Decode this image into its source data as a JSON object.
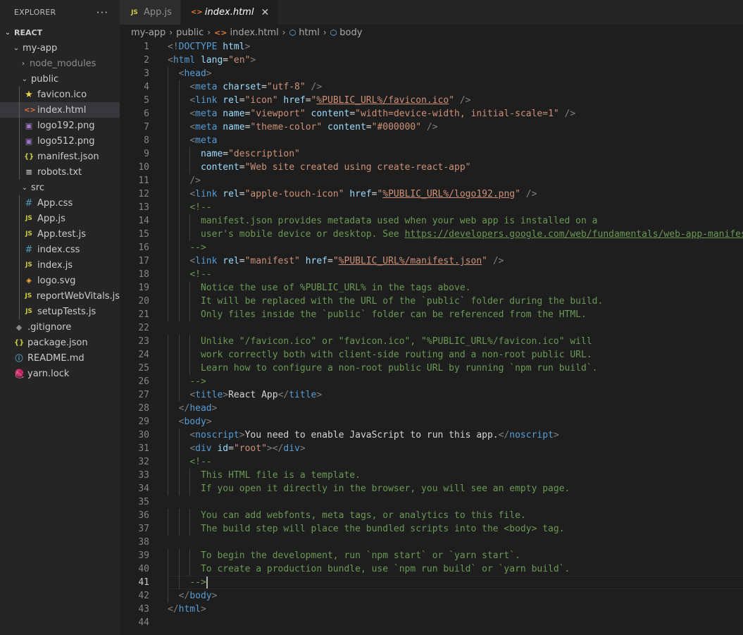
{
  "sidebar": {
    "title": "EXPLORER",
    "more": "···",
    "section": "REACT",
    "items": [
      {
        "label": "my-app",
        "kind": "folder",
        "depth": 1,
        "icon": "chevron-down-icon"
      },
      {
        "label": "node_modules",
        "kind": "folder",
        "depth": 2,
        "icon": "chevron-right-icon"
      },
      {
        "label": "public",
        "kind": "folder",
        "depth": 2,
        "icon": "chevron-down-icon"
      },
      {
        "label": "favicon.ico",
        "kind": "file",
        "depth": 3,
        "icon": "star-icon"
      },
      {
        "label": "index.html",
        "kind": "file",
        "depth": 3,
        "icon": "html-file-icon"
      },
      {
        "label": "logo192.png",
        "kind": "file",
        "depth": 3,
        "icon": "image-file-icon"
      },
      {
        "label": "logo512.png",
        "kind": "file",
        "depth": 3,
        "icon": "image-file-icon"
      },
      {
        "label": "manifest.json",
        "kind": "file",
        "depth": 3,
        "icon": "json-file-icon"
      },
      {
        "label": "robots.txt",
        "kind": "file",
        "depth": 3,
        "icon": "text-file-icon"
      },
      {
        "label": "src",
        "kind": "folder",
        "depth": 2,
        "icon": "chevron-down-icon"
      },
      {
        "label": "App.css",
        "kind": "file",
        "depth": 3,
        "icon": "css-file-icon"
      },
      {
        "label": "App.js",
        "kind": "file",
        "depth": 3,
        "icon": "js-file-icon"
      },
      {
        "label": "App.test.js",
        "kind": "file",
        "depth": 3,
        "icon": "js-test-file-icon"
      },
      {
        "label": "index.css",
        "kind": "file",
        "depth": 3,
        "icon": "css-file-icon"
      },
      {
        "label": "index.js",
        "kind": "file",
        "depth": 3,
        "icon": "js-file-icon"
      },
      {
        "label": "logo.svg",
        "kind": "file",
        "depth": 3,
        "icon": "svg-file-icon"
      },
      {
        "label": "reportWebVitals.js",
        "kind": "file",
        "depth": 3,
        "icon": "js-file-icon"
      },
      {
        "label": "setupTests.js",
        "kind": "file",
        "depth": 3,
        "icon": "js-file-icon"
      },
      {
        "label": ".gitignore",
        "kind": "file",
        "depth": 2,
        "icon": "git-file-icon"
      },
      {
        "label": "package.json",
        "kind": "file",
        "depth": 2,
        "icon": "json-file-icon"
      },
      {
        "label": "README.md",
        "kind": "file",
        "depth": 2,
        "icon": "info-file-icon"
      },
      {
        "label": "yarn.lock",
        "kind": "file",
        "depth": 2,
        "icon": "yarn-file-icon"
      }
    ],
    "selected": "index.html"
  },
  "tabs": [
    {
      "label": "App.js",
      "icon_text": "JS",
      "active": false
    },
    {
      "label": "index.html",
      "icon_text": "<>",
      "active": true,
      "close": "✕"
    }
  ],
  "breadcrumb": [
    "my-app",
    "public",
    "index.html",
    "html",
    "body"
  ],
  "editor": {
    "current_line": 41,
    "lines": [
      [
        [
          "t-p",
          "<!"
        ],
        [
          "t-tag",
          "DOCTYPE"
        ],
        [
          "t-txt",
          " "
        ],
        [
          "t-attr",
          "html"
        ],
        [
          "t-p",
          ">"
        ]
      ],
      [
        [
          "t-p",
          "<"
        ],
        [
          "t-tag",
          "html"
        ],
        [
          "t-txt",
          " "
        ],
        [
          "t-attr",
          "lang"
        ],
        [
          "t-txt",
          "="
        ],
        [
          "t-str",
          "\"en\""
        ],
        [
          "t-p",
          ">"
        ]
      ],
      [
        [
          "t-txt",
          "  "
        ],
        [
          "t-p",
          "<"
        ],
        [
          "t-tag",
          "head"
        ],
        [
          "t-p",
          ">"
        ]
      ],
      [
        [
          "t-txt",
          "    "
        ],
        [
          "t-p",
          "<"
        ],
        [
          "t-tag",
          "meta"
        ],
        [
          "t-txt",
          " "
        ],
        [
          "t-attr",
          "charset"
        ],
        [
          "t-txt",
          "="
        ],
        [
          "t-str",
          "\"utf-8\""
        ],
        [
          "t-txt",
          " "
        ],
        [
          "t-p",
          "/>"
        ]
      ],
      [
        [
          "t-txt",
          "    "
        ],
        [
          "t-p",
          "<"
        ],
        [
          "t-tag",
          "link"
        ],
        [
          "t-txt",
          " "
        ],
        [
          "t-attr",
          "rel"
        ],
        [
          "t-txt",
          "="
        ],
        [
          "t-str",
          "\"icon\""
        ],
        [
          "t-txt",
          " "
        ],
        [
          "t-attr",
          "href"
        ],
        [
          "t-txt",
          "="
        ],
        [
          "t-str",
          "\""
        ],
        [
          "t-url",
          "%PUBLIC_URL%/favicon.ico"
        ],
        [
          "t-str",
          "\""
        ],
        [
          "t-txt",
          " "
        ],
        [
          "t-p",
          "/>"
        ]
      ],
      [
        [
          "t-txt",
          "    "
        ],
        [
          "t-p",
          "<"
        ],
        [
          "t-tag",
          "meta"
        ],
        [
          "t-txt",
          " "
        ],
        [
          "t-attr",
          "name"
        ],
        [
          "t-txt",
          "="
        ],
        [
          "t-str",
          "\"viewport\""
        ],
        [
          "t-txt",
          " "
        ],
        [
          "t-attr",
          "content"
        ],
        [
          "t-txt",
          "="
        ],
        [
          "t-str",
          "\"width=device-width, initial-scale=1\""
        ],
        [
          "t-txt",
          " "
        ],
        [
          "t-p",
          "/>"
        ]
      ],
      [
        [
          "t-txt",
          "    "
        ],
        [
          "t-p",
          "<"
        ],
        [
          "t-tag",
          "meta"
        ],
        [
          "t-txt",
          " "
        ],
        [
          "t-attr",
          "name"
        ],
        [
          "t-txt",
          "="
        ],
        [
          "t-str",
          "\"theme-color\""
        ],
        [
          "t-txt",
          " "
        ],
        [
          "t-attr",
          "content"
        ],
        [
          "t-txt",
          "="
        ],
        [
          "t-str",
          "\"#000000\""
        ],
        [
          "t-txt",
          " "
        ],
        [
          "t-p",
          "/>"
        ]
      ],
      [
        [
          "t-txt",
          "    "
        ],
        [
          "t-p",
          "<"
        ],
        [
          "t-tag",
          "meta"
        ]
      ],
      [
        [
          "t-txt",
          "      "
        ],
        [
          "t-attr",
          "name"
        ],
        [
          "t-txt",
          "="
        ],
        [
          "t-str",
          "\"description\""
        ]
      ],
      [
        [
          "t-txt",
          "      "
        ],
        [
          "t-attr",
          "content"
        ],
        [
          "t-txt",
          "="
        ],
        [
          "t-str",
          "\"Web site created using create-react-app\""
        ]
      ],
      [
        [
          "t-txt",
          "    "
        ],
        [
          "t-p",
          "/>"
        ]
      ],
      [
        [
          "t-txt",
          "    "
        ],
        [
          "t-p",
          "<"
        ],
        [
          "t-tag",
          "link"
        ],
        [
          "t-txt",
          " "
        ],
        [
          "t-attr",
          "rel"
        ],
        [
          "t-txt",
          "="
        ],
        [
          "t-str",
          "\"apple-touch-icon\""
        ],
        [
          "t-txt",
          " "
        ],
        [
          "t-attr",
          "href"
        ],
        [
          "t-txt",
          "="
        ],
        [
          "t-str",
          "\""
        ],
        [
          "t-url",
          "%PUBLIC_URL%/logo192.png"
        ],
        [
          "t-str",
          "\""
        ],
        [
          "t-txt",
          " "
        ],
        [
          "t-p",
          "/>"
        ]
      ],
      [
        [
          "t-txt",
          "    "
        ],
        [
          "t-com",
          "<!--"
        ]
      ],
      [
        [
          "t-txt",
          "      "
        ],
        [
          "t-com",
          "manifest.json provides metadata used when your web app is installed on a"
        ]
      ],
      [
        [
          "t-txt",
          "      "
        ],
        [
          "t-com",
          "user's mobile device or desktop. See "
        ],
        [
          "t-comurl",
          "https://developers.google.com/web/fundamentals/web-app-manifest/"
        ]
      ],
      [
        [
          "t-txt",
          "    "
        ],
        [
          "t-com",
          "-->"
        ]
      ],
      [
        [
          "t-txt",
          "    "
        ],
        [
          "t-p",
          "<"
        ],
        [
          "t-tag",
          "link"
        ],
        [
          "t-txt",
          " "
        ],
        [
          "t-attr",
          "rel"
        ],
        [
          "t-txt",
          "="
        ],
        [
          "t-str",
          "\"manifest\""
        ],
        [
          "t-txt",
          " "
        ],
        [
          "t-attr",
          "href"
        ],
        [
          "t-txt",
          "="
        ],
        [
          "t-str",
          "\""
        ],
        [
          "t-url",
          "%PUBLIC_URL%/manifest.json"
        ],
        [
          "t-str",
          "\""
        ],
        [
          "t-txt",
          " "
        ],
        [
          "t-p",
          "/>"
        ]
      ],
      [
        [
          "t-txt",
          "    "
        ],
        [
          "t-com",
          "<!--"
        ]
      ],
      [
        [
          "t-txt",
          "      "
        ],
        [
          "t-com",
          "Notice the use of %PUBLIC_URL% in the tags above."
        ]
      ],
      [
        [
          "t-txt",
          "      "
        ],
        [
          "t-com",
          "It will be replaced with the URL of the `public` folder during the build."
        ]
      ],
      [
        [
          "t-txt",
          "      "
        ],
        [
          "t-com",
          "Only files inside the `public` folder can be referenced from the HTML."
        ]
      ],
      [],
      [
        [
          "t-txt",
          "      "
        ],
        [
          "t-com",
          "Unlike \"/favicon.ico\" or \"favicon.ico\", \"%PUBLIC_URL%/favicon.ico\" will"
        ]
      ],
      [
        [
          "t-txt",
          "      "
        ],
        [
          "t-com",
          "work correctly both with client-side routing and a non-root public URL."
        ]
      ],
      [
        [
          "t-txt",
          "      "
        ],
        [
          "t-com",
          "Learn how to configure a non-root public URL by running `npm run build`."
        ]
      ],
      [
        [
          "t-txt",
          "    "
        ],
        [
          "t-com",
          "-->"
        ]
      ],
      [
        [
          "t-txt",
          "    "
        ],
        [
          "t-p",
          "<"
        ],
        [
          "t-tag",
          "title"
        ],
        [
          "t-p",
          ">"
        ],
        [
          "t-txt",
          "React App"
        ],
        [
          "t-p",
          "</"
        ],
        [
          "t-tag",
          "title"
        ],
        [
          "t-p",
          ">"
        ]
      ],
      [
        [
          "t-txt",
          "  "
        ],
        [
          "t-p",
          "</"
        ],
        [
          "t-tag",
          "head"
        ],
        [
          "t-p",
          ">"
        ]
      ],
      [
        [
          "t-txt",
          "  "
        ],
        [
          "t-p",
          "<"
        ],
        [
          "t-tag",
          "body"
        ],
        [
          "t-p",
          ">"
        ]
      ],
      [
        [
          "t-txt",
          "    "
        ],
        [
          "t-p",
          "<"
        ],
        [
          "t-tag",
          "noscript"
        ],
        [
          "t-p",
          ">"
        ],
        [
          "t-txt",
          "You need to enable JavaScript to run this app."
        ],
        [
          "t-p",
          "</"
        ],
        [
          "t-tag",
          "noscript"
        ],
        [
          "t-p",
          ">"
        ]
      ],
      [
        [
          "t-txt",
          "    "
        ],
        [
          "t-p",
          "<"
        ],
        [
          "t-tag",
          "div"
        ],
        [
          "t-txt",
          " "
        ],
        [
          "t-attr",
          "id"
        ],
        [
          "t-txt",
          "="
        ],
        [
          "t-str",
          "\"root\""
        ],
        [
          "t-p",
          "></"
        ],
        [
          "t-tag",
          "div"
        ],
        [
          "t-p",
          ">"
        ]
      ],
      [
        [
          "t-txt",
          "    "
        ],
        [
          "t-com",
          "<!--"
        ]
      ],
      [
        [
          "t-txt",
          "      "
        ],
        [
          "t-com",
          "This HTML file is a template."
        ]
      ],
      [
        [
          "t-txt",
          "      "
        ],
        [
          "t-com",
          "If you open it directly in the browser, you will see an empty page."
        ]
      ],
      [],
      [
        [
          "t-txt",
          "      "
        ],
        [
          "t-com",
          "You can add webfonts, meta tags, or analytics to this file."
        ]
      ],
      [
        [
          "t-txt",
          "      "
        ],
        [
          "t-com",
          "The build step will place the bundled scripts into the <body> tag."
        ]
      ],
      [],
      [
        [
          "t-txt",
          "      "
        ],
        [
          "t-com",
          "To begin the development, run `npm start` or `yarn start`."
        ]
      ],
      [
        [
          "t-txt",
          "      "
        ],
        [
          "t-com",
          "To create a production bundle, use `npm run build` or `yarn build`."
        ]
      ],
      [
        [
          "t-txt",
          "    "
        ],
        [
          "t-com",
          "-->"
        ]
      ],
      [
        [
          "t-txt",
          "  "
        ],
        [
          "t-p",
          "</"
        ],
        [
          "t-tag",
          "body"
        ],
        [
          "t-p",
          ">"
        ]
      ],
      [
        [
          "t-p",
          "</"
        ],
        [
          "t-tag",
          "html"
        ],
        [
          "t-p",
          ">"
        ]
      ],
      []
    ]
  }
}
